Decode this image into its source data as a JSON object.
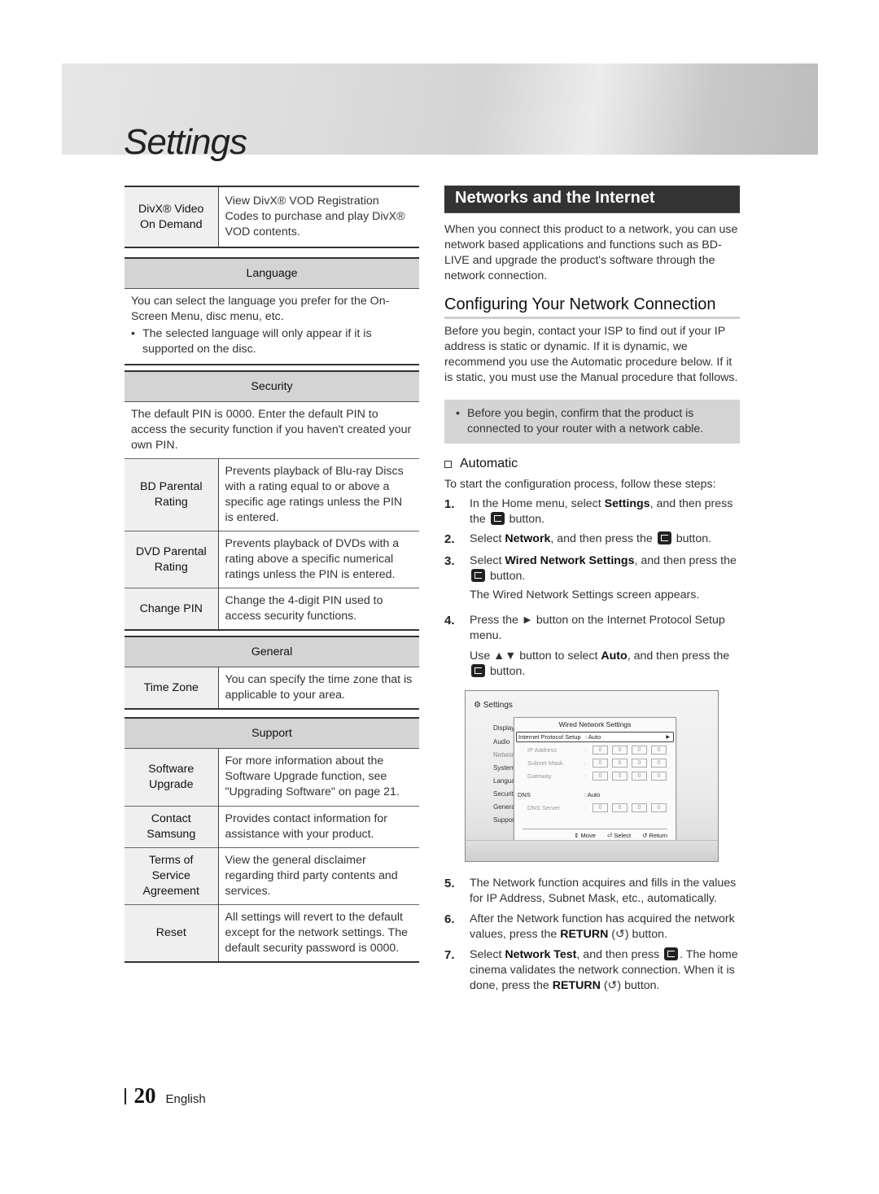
{
  "header": {
    "title": "Settings"
  },
  "left": {
    "divx": {
      "key": "DivX® Video On Demand",
      "value": "View DivX® VOD Registration Codes to purchase and play DivX® VOD contents."
    },
    "language": {
      "heading": "Language",
      "text": "You can select the language you prefer for the On-Screen Menu, disc menu, etc.",
      "bullet": "The selected language will only appear if it is supported on the disc."
    },
    "security": {
      "heading": "Security",
      "text": "The default PIN is 0000. Enter the default PIN to access the security function if you haven't created your own PIN.",
      "rows": [
        {
          "key": "BD Parental Rating",
          "value": "Prevents playback of Blu-ray Discs with a rating equal to or above a specific age ratings unless the PIN is entered."
        },
        {
          "key": "DVD Parental Rating",
          "value": "Prevents playback of DVDs with a rating above a specific numerical ratings unless the PIN is entered."
        },
        {
          "key": "Change PIN",
          "value": "Change the 4-digit PIN used to access security functions."
        }
      ]
    },
    "general": {
      "heading": "General",
      "rows": [
        {
          "key": "Time Zone",
          "value": "You can specify the time zone that is applicable to your area."
        }
      ]
    },
    "support": {
      "heading": "Support",
      "rows": [
        {
          "key": "Software Upgrade",
          "value": "For more information about the Software Upgrade function, see \"Upgrading Software\" on page 21."
        },
        {
          "key": "Contact Samsung",
          "value": "Provides contact information for assistance with your product."
        },
        {
          "key": "Terms of Service Agreement",
          "value": "View the general disclaimer regarding third party contents and services."
        },
        {
          "key": "Reset",
          "value": "All settings will revert to the default except for the network settings. The default security password is 0000."
        }
      ]
    }
  },
  "right": {
    "section_title": "Networks and the Internet",
    "intro": "When you connect this product to a network, you can use network based applications and functions such as BD-LIVE and upgrade the product's software through the network connection.",
    "subsection_title": "Configuring Your Network Connection",
    "sub_intro": "Before you begin, contact your ISP to find out if your IP address is static or dynamic. If it is dynamic, we recommend you use the Automatic procedure below. If it is static, you must use the Manual procedure that follows.",
    "note": "Before you begin, confirm that the product is connected to your router with a network cable.",
    "automatic_heading": "Automatic",
    "steps_intro": "To start the configuration process, follow these steps:",
    "steps": {
      "s1": {
        "num": "1.",
        "a": "In the Home menu, select ",
        "b": "Settings",
        "c": ", and then press the",
        "d": "button."
      },
      "s2": {
        "num": "2.",
        "a": "Select ",
        "b": "Network",
        "c": ", and then press the",
        "d": "button."
      },
      "s3": {
        "num": "3.",
        "a": "Select ",
        "b": "Wired Network Settings",
        "c": ", and then press the",
        "d": "button.",
        "e": "The Wired Network Settings screen appears."
      },
      "s4": {
        "num": "4.",
        "a": "Press the ► button on the Internet Protocol Setup menu.",
        "b": "Use ▲▼ button to select ",
        "c": "Auto",
        "d": ", and then press the",
        "e": "button."
      },
      "s5": {
        "num": "5.",
        "a": "The Network function acquires and fills in the values for IP Address, Subnet Mask, etc., automatically."
      },
      "s6": {
        "num": "6.",
        "a": "After the Network function has acquired the network values, press the ",
        "b": "RETURN",
        "c": " (↺) button."
      },
      "s7": {
        "num": "7.",
        "a": "Select ",
        "b": "Network Test",
        "c": ", and then press",
        "d": ". The home cinema validates the network connection. When it is done, press the ",
        "e": "RETURN",
        "f": " (↺) button."
      }
    },
    "screen": {
      "title": "Settings",
      "side_menu": [
        "Display",
        "Audio",
        "Network",
        "System",
        "Language",
        "Security",
        "General",
        "Support"
      ],
      "dialog_title": "Wired Network Settings",
      "ip_setup_label": "Internet Protocol Setup",
      "ip_setup_value": ": Auto",
      "ip_label": "IP Address",
      "mask_label": "Subnet Mask",
      "gateway_label": "Gateway",
      "dns_label": "DNS",
      "dns_value": ": Auto",
      "dns_server_label": "DNS Server",
      "octet": "0",
      "colon": ":",
      "footer_move": "⇕ Move",
      "footer_select": "⏎ Select",
      "footer_return": "↺ Return"
    }
  },
  "footer": {
    "page_number": "20",
    "language": "English"
  }
}
